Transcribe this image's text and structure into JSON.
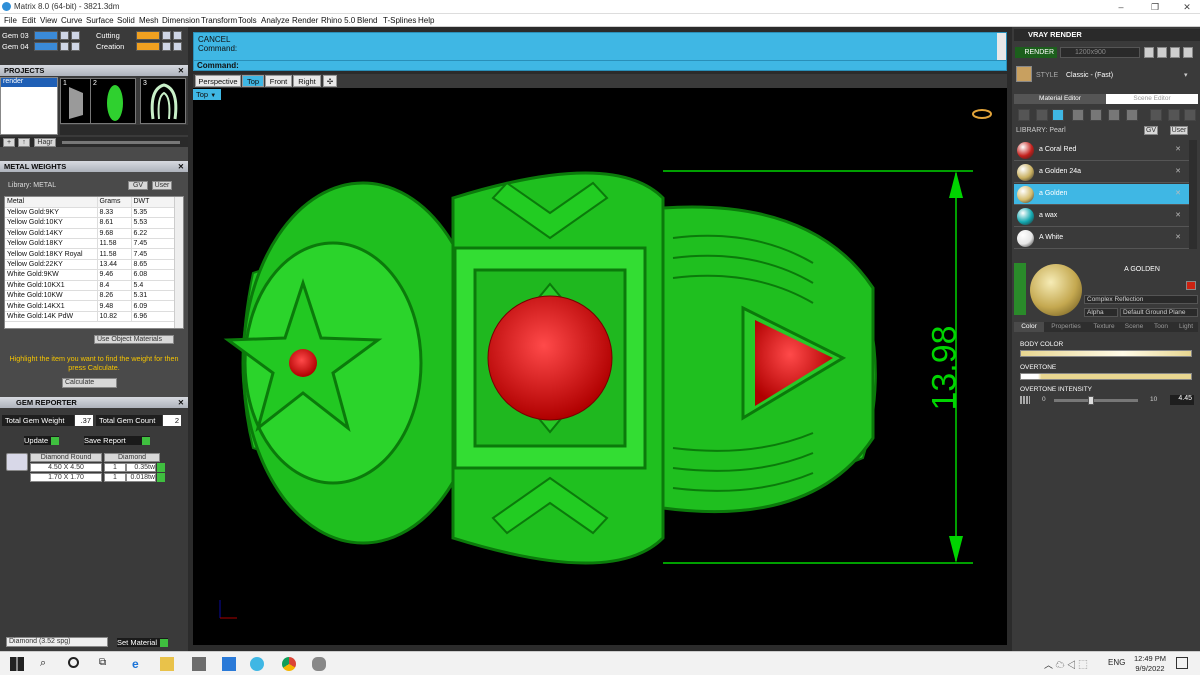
{
  "window": {
    "title": "Matrix 8.0 (64-bit) - 3821.3dm",
    "controls": [
      "–",
      "❐",
      "✕"
    ]
  },
  "menu": [
    "File",
    "Edit",
    "View",
    "Curve",
    "Surface",
    "Solid",
    "Mesh",
    "Dimension",
    "Transform",
    "Tools",
    "Analyze",
    "Render",
    "Rhino 5.0",
    "Blend",
    "T-Splines",
    "Help"
  ],
  "gem_layers": [
    {
      "label": "Gem 03",
      "color": "#3a8ad8"
    },
    {
      "label": "Gem 04",
      "color": "#3a8ad8"
    },
    {
      "label": "Cutting",
      "color": "#f0a020"
    },
    {
      "label": "Creation",
      "color": "#f0a020"
    }
  ],
  "projects": {
    "title": "PROJECTS",
    "list_item": "render",
    "thumbs": [
      "1",
      "2",
      "3"
    ],
    "toolbar": [
      "+",
      "↑",
      "Hagr"
    ]
  },
  "metal_weights": {
    "title": "METAL WEIGHTS",
    "library_label": "Library: METAL",
    "library_btns": [
      "GV",
      "User"
    ],
    "columns": [
      "Metal",
      "Grams",
      "DWT"
    ],
    "rows": [
      [
        "Yellow Gold:9KY",
        "8.33",
        "5.35"
      ],
      [
        "Yellow Gold:10KY",
        "8.61",
        "5.53"
      ],
      [
        "Yellow Gold:14KY",
        "9.68",
        "6.22"
      ],
      [
        "Yellow Gold:18KY",
        "11.58",
        "7.45"
      ],
      [
        "Yellow Gold:18KY Royal",
        "11.58",
        "7.45"
      ],
      [
        "Yellow Gold:22KY",
        "13.44",
        "8.65"
      ],
      [
        "White Gold:9KW",
        "9.46",
        "6.08"
      ],
      [
        "White Gold:10KX1",
        "8.4",
        "5.4"
      ],
      [
        "White Gold:10KW",
        "8.26",
        "5.31"
      ],
      [
        "White Gold:14KX1",
        "9.48",
        "6.09"
      ],
      [
        "White Gold:14K PdW",
        "10.82",
        "6.96"
      ]
    ],
    "use_object_materials": "Use Object Materials",
    "hint": "Highlight the item you want to find the weight for then press Calculate.",
    "calculate": "Calculate"
  },
  "gem_reporter": {
    "title": "GEM REPORTER",
    "total_weight_label": "Total Gem Weight",
    "total_weight": ".37",
    "total_count_label": "Total Gem Count",
    "total_count": "2",
    "update": "Update",
    "save_report": "Save Report",
    "header": [
      "Diamond Round",
      "Diamond"
    ],
    "rows": [
      [
        "4.50 X 4.50",
        "1",
        "0.35tw"
      ],
      [
        "1.70 X 1.70",
        "1",
        "0.018tw"
      ]
    ],
    "material_select": "Diamond   (3.52 spg)",
    "set_material": "Set Material"
  },
  "command": {
    "line1": "CANCEL",
    "line2": "Command:",
    "prompt": "Command:"
  },
  "view_tabs": [
    "Perspective",
    "Top",
    "Front",
    "Right"
  ],
  "active_view": "Top",
  "dimension_value": "13.98",
  "vray": {
    "title": "VRAY RENDER",
    "render_btn": "RENDER",
    "resolution": "1200x900",
    "style_label": "STYLE",
    "style_value": "Classic - (Fast)",
    "tabs": [
      "Material Editor",
      "Scene Editor"
    ],
    "library": "LIBRARY: Pearl",
    "library_btns": [
      "GV",
      "User"
    ],
    "materials": [
      {
        "name": "a Coral Red",
        "color": "#c4201c"
      },
      {
        "name": "a Golden 24a",
        "color": "#c9b060"
      },
      {
        "name": "a Golden",
        "color": "#d4bd6e"
      },
      {
        "name": "a wax",
        "color": "#13a8b0"
      },
      {
        "name": "A White",
        "color": "#e6e6e6"
      }
    ],
    "selected_index": 2,
    "preview_name": "A GOLDEN",
    "preview_mode": "Complex Reflection",
    "alpha_label": "Alpha",
    "ground": "Default Ground Plane",
    "prop_tabs": [
      "Color",
      "Properties",
      "Texture",
      "Scene",
      "Toon",
      "Light"
    ],
    "body_color_label": "BODY COLOR",
    "overtone_label": "OVERTONE",
    "overtone_intensity_label": "OVERTONE INTENSITY",
    "intensity_min": "0",
    "intensity_max": "10",
    "intensity_value": "4.45",
    "intensity_fraction": 0.445
  },
  "taskbar": {
    "time": "12:49 PM",
    "date": "9/9/2022",
    "lang": "ENG"
  }
}
